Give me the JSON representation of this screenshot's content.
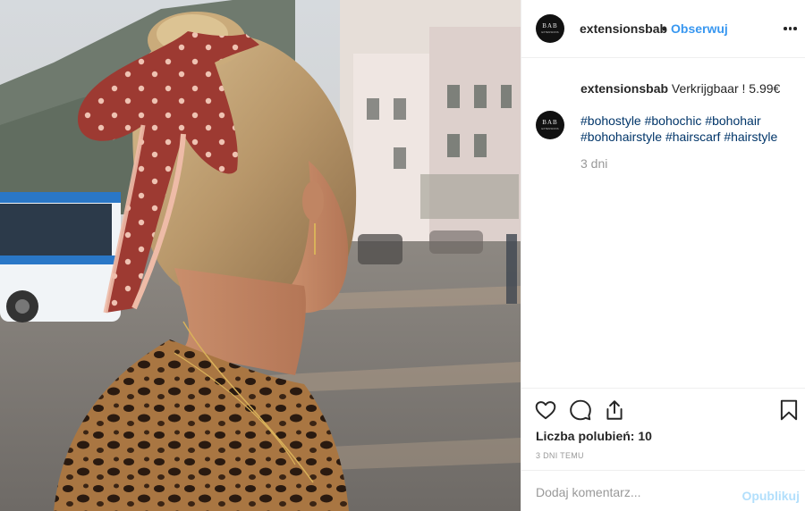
{
  "post": {
    "username": "extensionsbab",
    "separator": "•",
    "follow_label": "Obserwuj",
    "avatar": {
      "monogram": "BAB",
      "subtext": "EXTENSIONS"
    },
    "caption": "Verkrijgbaar ! 5.99€",
    "hashtags": [
      "#bohostyle",
      "#bohochic",
      "#bohohair",
      "#bohohairstyle",
      "#hairscarf",
      "#hairstyle"
    ],
    "comment_age": "3 dni",
    "likes_label": "Liczba polubień: 10",
    "timestamp": "3 DNI TEMU",
    "comment_placeholder": "Dodaj komentarz...",
    "post_label": "Opublikuj"
  },
  "icons": {
    "more": "more-options-icon",
    "like": "heart-icon",
    "comment": "comment-bubble-icon",
    "share": "share-upload-icon",
    "save": "bookmark-icon"
  },
  "colors": {
    "link": "#3897f0",
    "hashtag": "#003569",
    "muted": "#999999",
    "post_disabled": "#b2dffc"
  }
}
